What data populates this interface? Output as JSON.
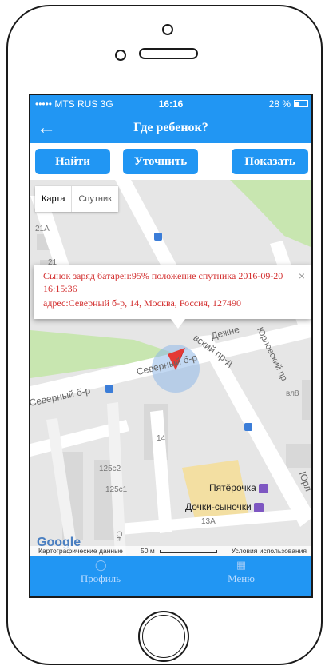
{
  "status_bar": {
    "carrier": "••••• MTS RUS  3G",
    "time": "16:16",
    "battery": "28 %"
  },
  "nav": {
    "title": "Где ребенок?",
    "back_icon": "arrow-left-icon"
  },
  "toolbar": {
    "find_label": "Найти",
    "refine_label": "Уточнить",
    "show_label": "Показать"
  },
  "map_type": {
    "map_label": "Карта",
    "satellite_label": "Спутник"
  },
  "popup": {
    "line1": "Сынок    заряд батарен:95%   положение спутника  2016-09-20 16:15:36",
    "line2": "адрес:Северный б-р, 14, Москва, Россия, 127490",
    "close": "×"
  },
  "map": {
    "labels": {
      "bldg_21a": "21А",
      "bldg_21": "21",
      "bldg_14": "14",
      "bldg_125s2": "125с2",
      "bldg_125s1": "125с1",
      "bldg_13a": "13А",
      "bldg_vl8": "вл8",
      "bldg_se": "Се"
    },
    "streets": {
      "severny_left": "Северный б-р",
      "severny_mid": "Северный б-р",
      "dezhnev": "Дежне",
      "yurlovsky": "Юрловский пр",
      "yurl_edge": "Юрл",
      "proezd": "вский пр-д"
    },
    "pois": {
      "pyaterochka": "Пятёрочка",
      "dochki": "Дочки-сыночки"
    },
    "google": "Google",
    "attribution": {
      "data": "Картографические данные",
      "scale": "50 м",
      "terms": "Условия использования"
    },
    "colors": {
      "park": "#c8e6b0",
      "road": "#ffffff",
      "block": "#dcdcdc",
      "marker": "#e53935",
      "accuracy": "#90b8e8",
      "poi_block": "#f3dfa2"
    }
  },
  "tabbar": {
    "profile": {
      "label": "Профиль",
      "icon": "person-icon"
    },
    "menu": {
      "label": "Меню",
      "icon": "book-icon"
    }
  },
  "colors": {
    "primary": "#2196f3",
    "popup_text": "#d32f2f"
  }
}
